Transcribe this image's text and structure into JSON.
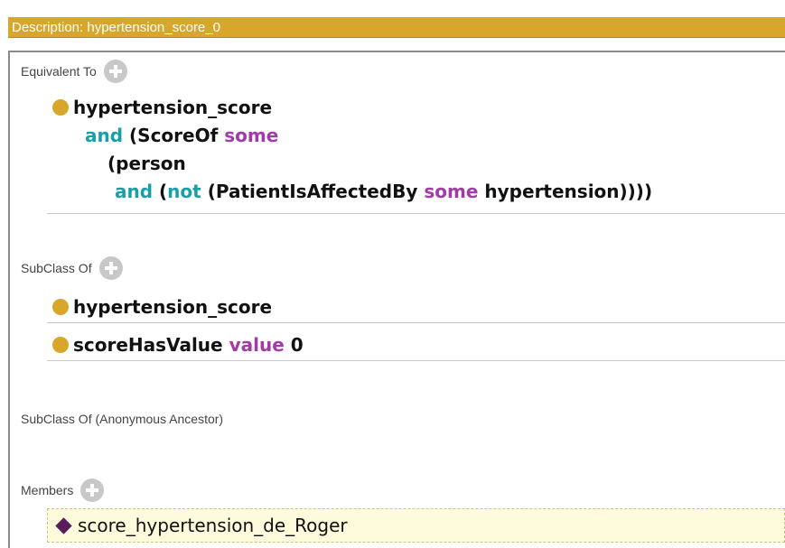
{
  "header": {
    "title": "Description: hypertension_score_0"
  },
  "equivalent_to": {
    "label": "Equivalent To",
    "class_name": "hypertension_score",
    "kw_and_1": "and",
    "score_of": "(ScoreOf",
    "kw_some_1": "some",
    "person": "(person",
    "kw_and_2": "and",
    "open_paren": "(",
    "kw_not": "not",
    "patient_affected": "(PatientIsAffectedBy",
    "kw_some_2": "some",
    "hypertension_close": "hypertension))))"
  },
  "subclass_of": {
    "label": "SubClass Of",
    "items": [
      {
        "class_name": "hypertension_score"
      },
      {
        "property": "scoreHasValue",
        "keyword": "value",
        "value": "0"
      }
    ]
  },
  "anonymous_ancestor": {
    "label": "SubClass Of (Anonymous Ancestor)"
  },
  "members": {
    "label": "Members",
    "items": [
      {
        "name": "score_hypertension_de_Roger"
      }
    ]
  },
  "colors": {
    "header_bg": "#d8a62a",
    "class_dot": "#d8a62a",
    "keyword_teal": "#1a9fa6",
    "keyword_purple": "#a23aa8",
    "individual_diamond": "#5a1c5a"
  },
  "icons": [
    "add-icon",
    "class-icon",
    "individual-icon"
  ]
}
